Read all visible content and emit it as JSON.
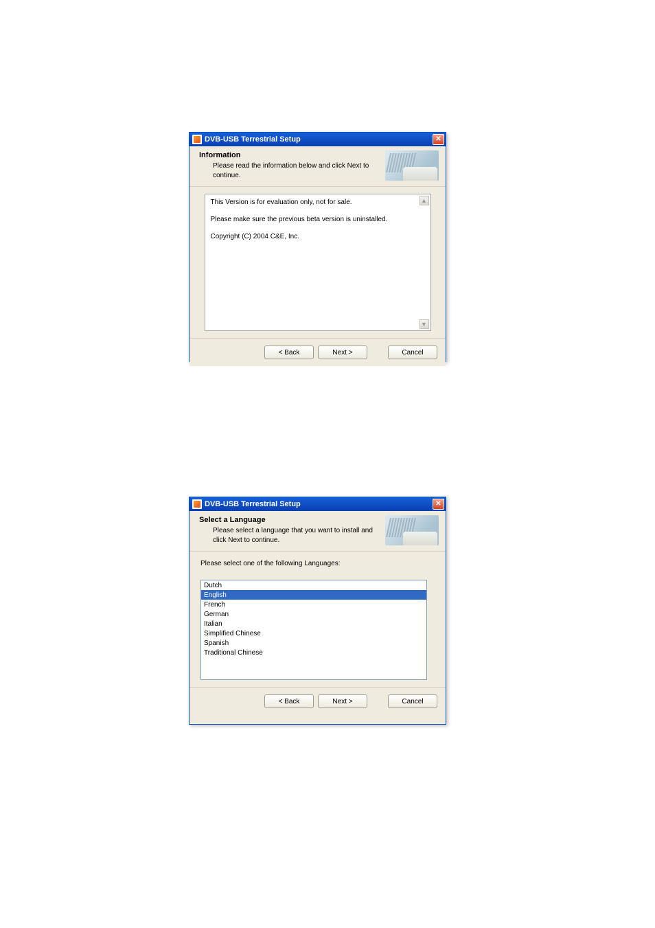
{
  "dialog1": {
    "title": "DVB-USB Terrestrial Setup",
    "header": {
      "title": "Information",
      "subtitle": "Please read the information below and click Next to continue."
    },
    "info_lines": {
      "l1": "This Version is for evaluation only, not for sale.",
      "l2": "Please make sure the previous beta version is uninstalled.",
      "l3": "Copyright (C) 2004 C&E, Inc."
    },
    "buttons": {
      "back": "< Back",
      "next": "Next >",
      "cancel": "Cancel"
    }
  },
  "dialog2": {
    "title": "DVB-USB Terrestrial Setup",
    "header": {
      "title": "Select a Language",
      "subtitle": "Please select a language that you want to install and click Next to continue."
    },
    "prompt": "Please select one of the following Languages:",
    "languages": {
      "l0": "Dutch",
      "l1": "English",
      "l2": "French",
      "l3": "German",
      "l4": "Italian",
      "l5": "Simplified Chinese",
      "l6": "Spanish",
      "l7": "Traditional Chinese"
    },
    "selected_index": 1,
    "buttons": {
      "back": "< Back",
      "next": "Next >",
      "cancel": "Cancel"
    }
  }
}
